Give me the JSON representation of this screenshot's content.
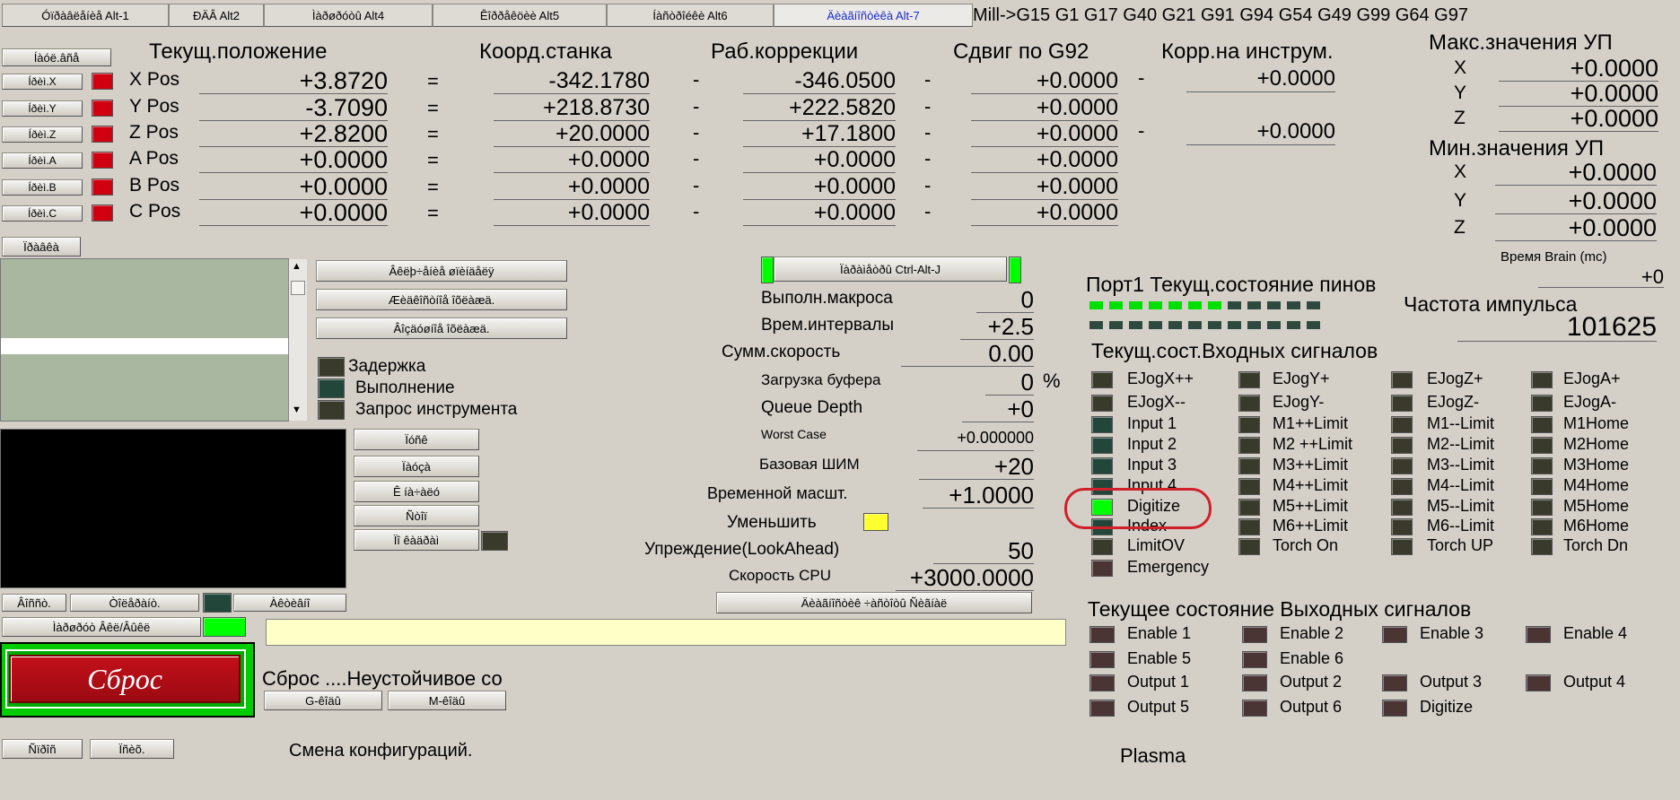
{
  "tabs": [
    {
      "label": "Óïðàâëåíèå Alt-1",
      "active": false
    },
    {
      "label": "ÐÄÂ Alt2",
      "active": false
    },
    {
      "label": "Ìàðøðóòû Alt4",
      "active": false
    },
    {
      "label": "Êîððåêöèè Alt5",
      "active": false
    },
    {
      "label": "Íàñòðîéêè Alt6",
      "active": false
    },
    {
      "label": "Äèàãíîñòèêà Alt-7",
      "active": true
    }
  ],
  "gcodes": "Mill->G15  G1 G17 G40 G21 G91 G94 G54 G49 G99 G64 G97",
  "dro": {
    "ref_all_button": "Íàóë.âñå",
    "ref_buttons": [
      "Íðèì.X",
      "Íðèì.Y",
      "Íðèì.Z",
      "Íðèì.A",
      "Íðèì.B",
      "Íðèì.C"
    ],
    "ref_led_color": "#d00010",
    "headers": {
      "current": "Текущ.положение",
      "machine": "Коорд.станка",
      "work": "Раб.коррекции",
      "g92": "Сдвиг по G92",
      "tool": "Корр.на инструм."
    },
    "axes": [
      {
        "label": "X Pos",
        "current": "+3.8720",
        "machine": "-342.1780",
        "work": "-346.0500",
        "g92": "+0.0000",
        "tool": "+0.0000"
      },
      {
        "label": "Y Pos",
        "current": "-3.7090",
        "machine": "+218.8730",
        "work": "+222.5820",
        "g92": "+0.0000",
        "tool": ""
      },
      {
        "label": "Z Pos",
        "current": "+2.8200",
        "machine": "+20.0000",
        "work": "+17.1800",
        "g92": "+0.0000",
        "tool": "+0.0000"
      },
      {
        "label": "A Pos",
        "current": "+0.0000",
        "machine": "+0.0000",
        "work": "+0.0000",
        "g92": "+0.0000",
        "tool": ""
      },
      {
        "label": "B Pos",
        "current": "+0.0000",
        "machine": "+0.0000",
        "work": "+0.0000",
        "g92": "+0.0000",
        "tool": ""
      },
      {
        "label": "C Pos",
        "current": "+0.0000",
        "machine": "+0.0000",
        "work": "+0.0000",
        "g92": "+0.0000",
        "tool": ""
      }
    ],
    "equal_sign": "=",
    "minus_sign": "-",
    "return_button": "Ïðàâêà"
  },
  "limits": {
    "max_title": "Макс.значения УП",
    "min_title": "Мин.значения УП",
    "max": [
      {
        "axis": "X",
        "value": "+0.0000"
      },
      {
        "axis": "Y",
        "value": "+0.0000"
      },
      {
        "axis": "Z",
        "value": "+0.0000"
      }
    ],
    "min": [
      {
        "axis": "X",
        "value": "+0.0000"
      },
      {
        "axis": "Y",
        "value": "+0.0000"
      },
      {
        "axis": "Z",
        "value": "+0.0000"
      }
    ],
    "brain_label": "Время Brain (mc)",
    "brain_value": "+0"
  },
  "left_buttons": [
    "Âêëþ÷åíèå øïèíäåëÿ",
    "Æèäêîñòíîå îõëàæä.",
    "Âîçäóøíîå îõëàæä."
  ],
  "status_leds": [
    {
      "label": "Задержка",
      "color": "#3a3a2c"
    },
    {
      "label": "Выполнение",
      "color": "#23463a"
    },
    {
      "label": "Запрос инструмента",
      "color": "#3a3a2c"
    }
  ],
  "mid_buttons": [
    "Ïóñê",
    "Ïàóçà",
    "Ê íà÷àëó",
    "Ñòîï",
    "Ïî êàäðàì"
  ],
  "lower_buttons": {
    "b1": "Âîññò.",
    "b2": "Òîëåðàíò.",
    "b3": "Àêòèâíî",
    "b4": "Ìàðøðóò Âêë/Âûêë",
    "b5": "Ñïðîñ",
    "b6": "Ïñèõ."
  },
  "reset": {
    "label": "Сброс",
    "status_text": "Сброс ....Неустойчивое со",
    "gcode_btn": "G-êîäû",
    "mcode_btn": "M-êîäû"
  },
  "config_text": "Смена конфигураций.",
  "plasma_text": "Plasma",
  "timing": {
    "jog_button": "Ïàðàìåòðû Ctrl-Alt-J",
    "rows": [
      {
        "label": "Выполн.макроса",
        "value": "0"
      },
      {
        "label": "Врем.интервалы",
        "value": "+2.5"
      },
      {
        "label": "Сумм.скорость",
        "value": "0.00"
      },
      {
        "label": "Загрузка буфера",
        "value": "0",
        "unit": "%"
      },
      {
        "label": "Queue Depth",
        "value": "+0"
      },
      {
        "label": "Worst Case",
        "value": "+0.000000"
      },
      {
        "label": "Базовая ШИМ",
        "value": "+20"
      },
      {
        "label": "Временной масшт.",
        "value": "+1.0000"
      },
      {
        "label": "Уменьшить",
        "value": ""
      },
      {
        "label": "Упреждение(LookAhead)",
        "value": "50"
      },
      {
        "label": "Скорость CPU",
        "value": "+3000.0000"
      }
    ],
    "bottom_button": "Äèàãíîñòèê ÷àñòîòû Ñèãíàë",
    "reduce_led_color": "#ffff30"
  },
  "port": {
    "title": "Порт1 Текущ.состояние пинов",
    "pins_row1": [
      true,
      true,
      true,
      true,
      true,
      true,
      true,
      false,
      false,
      false,
      false,
      false
    ],
    "pins_row2": [
      false,
      false,
      false,
      false,
      false,
      false,
      false,
      false,
      false,
      false,
      false,
      false
    ],
    "freq_label": "Частота импульса",
    "freq_value": "101625"
  },
  "inputs": {
    "title": "Текущ.сост.Входных сигналов",
    "col1": [
      {
        "label": "EJogX++",
        "color": "#3a3a2c"
      },
      {
        "label": "EJogX--",
        "color": "#3a3a2c"
      },
      {
        "label": "Input 1",
        "color": "#23463a"
      },
      {
        "label": "Input 2",
        "color": "#23463a"
      },
      {
        "label": "Input 3",
        "color": "#23463a"
      },
      {
        "label": "Input 4",
        "color": "#23463a"
      },
      {
        "label": "Digitize",
        "color": "#00ff00"
      },
      {
        "label": "Index",
        "color": "#23463a"
      },
      {
        "label": "LimitOV",
        "color": "#3a3a2c"
      },
      {
        "label": "Emergency",
        "color": "#4a3434"
      }
    ],
    "col2": [
      {
        "label": "EJogY+",
        "color": "#3a3a2c"
      },
      {
        "label": "EJogY-",
        "color": "#3a3a2c"
      },
      {
        "label": "M1++Limit",
        "color": "#3a3a2c"
      },
      {
        "label": "M2 ++Limit",
        "color": "#3a3a2c"
      },
      {
        "label": "M3++Limit",
        "color": "#3a3a2c"
      },
      {
        "label": "M4++Limit",
        "color": "#3a3a2c"
      },
      {
        "label": "M5++Limit",
        "color": "#3a3a2c"
      },
      {
        "label": "M6++Limit",
        "color": "#3a3a2c"
      },
      {
        "label": "Torch On",
        "color": "#3a3a2c"
      }
    ],
    "col3": [
      {
        "label": "EJogZ+",
        "color": "#3a3a2c"
      },
      {
        "label": "EJogZ-",
        "color": "#3a3a2c"
      },
      {
        "label": "M1--Limit",
        "color": "#3a3a2c"
      },
      {
        "label": "M2--Limit",
        "color": "#3a3a2c"
      },
      {
        "label": "M3--Limit",
        "color": "#3a3a2c"
      },
      {
        "label": "M4--Limit",
        "color": "#3a3a2c"
      },
      {
        "label": "M5--Limit",
        "color": "#3a3a2c"
      },
      {
        "label": "M6--Limit",
        "color": "#3a3a2c"
      },
      {
        "label": "Torch UP",
        "color": "#3a3a2c"
      }
    ],
    "col4": [
      {
        "label": "EJogA+",
        "color": "#3a3a2c"
      },
      {
        "label": "EJogA-",
        "color": "#3a3a2c"
      },
      {
        "label": "M1Home",
        "color": "#3a3a2c"
      },
      {
        "label": "M2Home",
        "color": "#3a3a2c"
      },
      {
        "label": "M3Home",
        "color": "#3a3a2c"
      },
      {
        "label": "M4Home",
        "color": "#3a3a2c"
      },
      {
        "label": "M5Home",
        "color": "#3a3a2c"
      },
      {
        "label": "M6Home",
        "color": "#3a3a2c"
      },
      {
        "label": "Torch Dn",
        "color": "#3a3a2c"
      }
    ]
  },
  "outputs": {
    "title": "Текущее состояние Выходных сигналов",
    "rows": [
      [
        "Enable 1",
        "Enable 2",
        "Enable 3",
        "Enable 4"
      ],
      [
        "Enable 5",
        "Enable 6",
        "",
        ""
      ],
      [
        "Output 1",
        "Output 2",
        "Output 3",
        "Output 4"
      ],
      [
        "Output 5",
        "Output 6",
        "Digitize",
        ""
      ]
    ],
    "led_color": "#4a3434"
  },
  "highlight_color": "#d0202a"
}
